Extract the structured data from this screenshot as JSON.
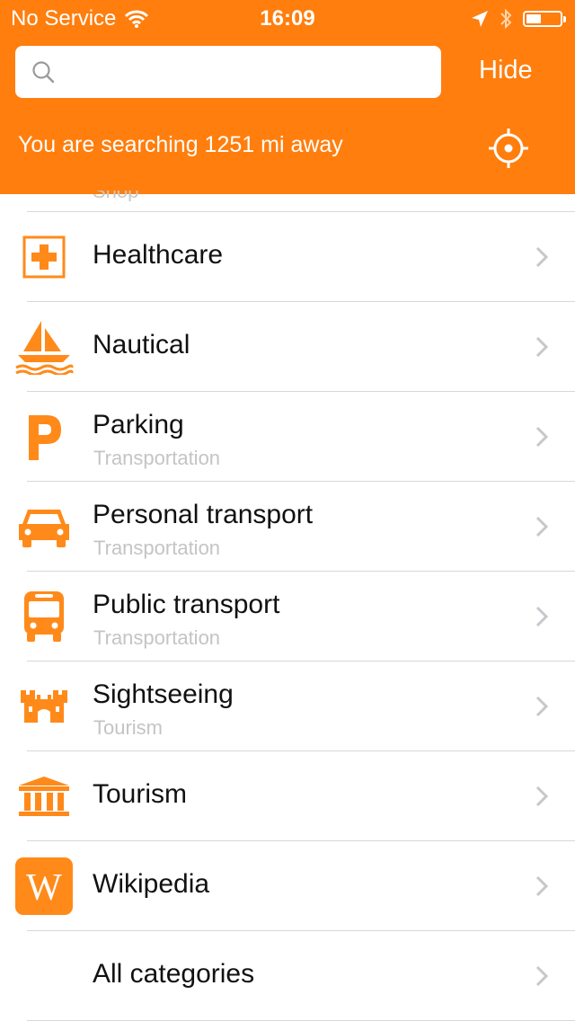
{
  "status_bar": {
    "carrier": "No Service",
    "time": "16:09"
  },
  "search": {
    "placeholder": "",
    "value": "",
    "hide_label": "Hide"
  },
  "info": {
    "distance_text": "You are searching 1251 mi away"
  },
  "colors": {
    "accent": "#ff7e0d",
    "subtitle": "#c4c4c4",
    "separator": "#d8d8d8"
  },
  "list": {
    "partial_above_subtitle": "Shop",
    "items": [
      {
        "title": "Healthcare",
        "subtitle": "",
        "icon": "healthcare-cross-icon"
      },
      {
        "title": "Nautical",
        "subtitle": "",
        "icon": "sailboat-icon"
      },
      {
        "title": "Parking",
        "subtitle": "Transportation",
        "icon": "parking-p-icon"
      },
      {
        "title": "Personal transport",
        "subtitle": "Transportation",
        "icon": "car-icon"
      },
      {
        "title": "Public transport",
        "subtitle": "Transportation",
        "icon": "bus-icon"
      },
      {
        "title": "Sightseeing",
        "subtitle": "Tourism",
        "icon": "castle-icon"
      },
      {
        "title": "Tourism",
        "subtitle": "",
        "icon": "museum-icon"
      },
      {
        "title": "Wikipedia",
        "subtitle": "",
        "icon": "wikipedia-icon"
      },
      {
        "title": "All categories",
        "subtitle": "",
        "icon": ""
      }
    ]
  }
}
